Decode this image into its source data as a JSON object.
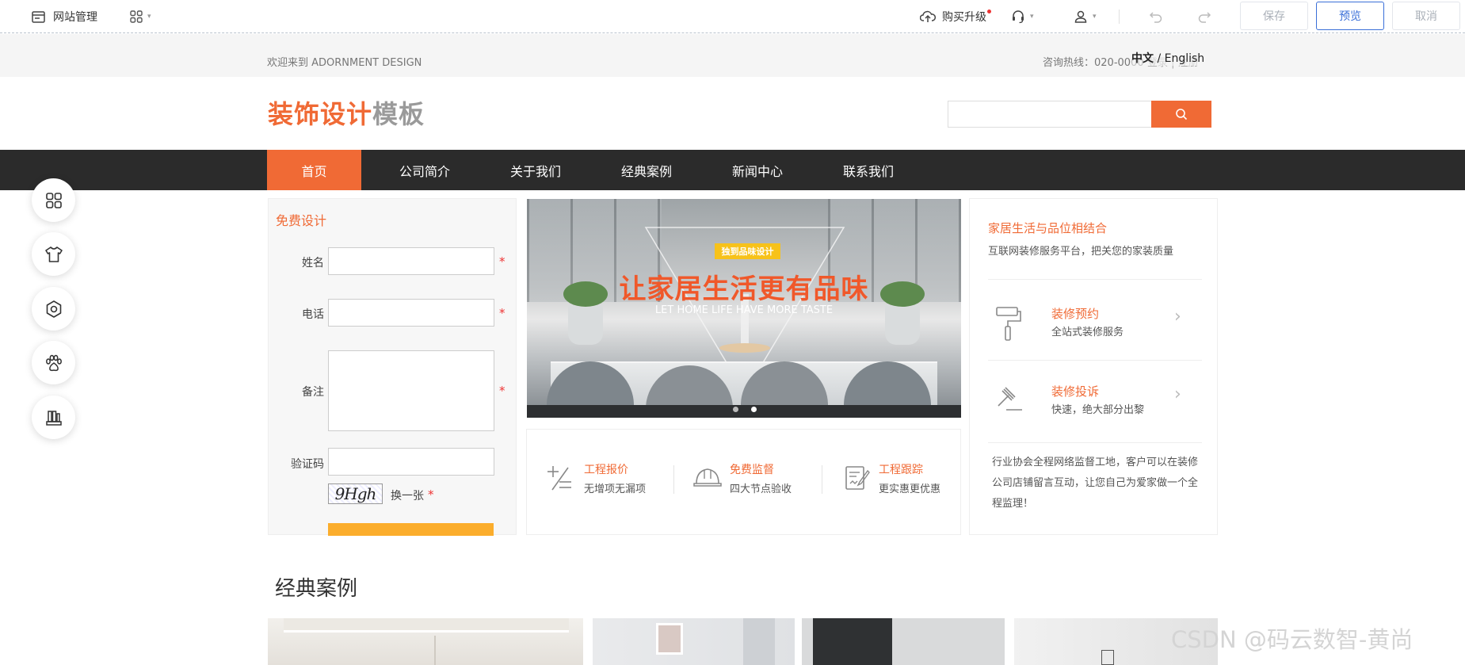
{
  "toolbar": {
    "site_manage": "网站管理",
    "upgrade": "购买升级",
    "save": "保存",
    "preview": "预览",
    "cancel": "取消"
  },
  "topbar": {
    "welcome": "欢迎来到 ADORNMENT DESIGN",
    "hotline": "咨询热线：020-0000",
    "login_links": "登录 | 注册",
    "lang_cn": "中文",
    "lang_sep": "/",
    "lang_en": "English"
  },
  "logo": {
    "part_a": "装饰设计",
    "part_b": "模板"
  },
  "nav": [
    "首页",
    "公司简介",
    "关于我们",
    "经典案例",
    "新闻中心",
    "联系我们"
  ],
  "form": {
    "title": "免费设计",
    "name_label": "姓名",
    "phone_label": "电话",
    "remark_label": "备注",
    "captcha_label": "验证码",
    "captcha_text": "9Hgh",
    "refresh": "换一张",
    "required": "*"
  },
  "banner": {
    "badge": "独到品味设计",
    "title": "让家居生活更有品味",
    "subtitle": "LET HOME LIFE HAVE MORE TASTE"
  },
  "features": [
    {
      "title": "工程报价",
      "sub": "无增项无漏项",
      "icon": "plus-minus-icon"
    },
    {
      "title": "免费监督",
      "sub": "四大节点验收",
      "icon": "helmet-icon"
    },
    {
      "title": "工程跟踪",
      "sub": "更实惠更优惠",
      "icon": "document-pen-icon"
    }
  ],
  "right": {
    "title": "家居生活与品位相结合",
    "sub": "互联网装修服务平台，把关您的家装质量",
    "items": [
      {
        "title": "装修预约",
        "sub": "全站式装修服务",
        "icon": "paint-roller-icon"
      },
      {
        "title": "装修投诉",
        "sub": "快速，绝大部分出黎",
        "icon": "gavel-icon"
      }
    ],
    "desc": "行业协会全程网络监督工地，客户可以在装修公司店铺留言互动，让您自己为爱家做一个全程监理！"
  },
  "section": {
    "cases_title": "经典案例"
  },
  "watermark": "CSDN @码云数智-黄尚",
  "colors": {
    "accent": "#f06a35",
    "nav_bg": "#2b2b2b",
    "primary_blue": "#3a6fd8",
    "submit": "#fbad2c"
  }
}
